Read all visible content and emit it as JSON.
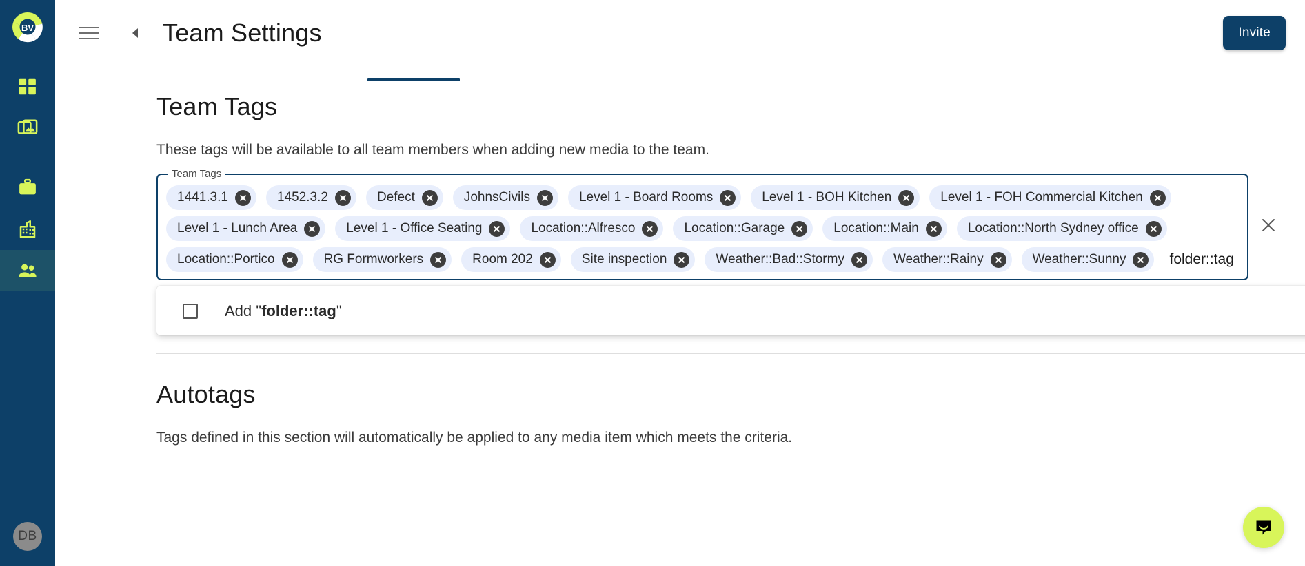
{
  "colors": {
    "sidebar_bg": "#0d4068",
    "sidebar_accent": "#d8f55a",
    "sidebar_active": "#1d5268",
    "primary": "#0d4068",
    "chip_bg": "#e8eefc",
    "chat_bubble": "#d8f55a"
  },
  "sidebar": {
    "logo_text": "BV",
    "items": [
      {
        "name": "dashboard",
        "icon": "grid-icon"
      },
      {
        "name": "media",
        "icon": "photo-library-icon"
      },
      {
        "name": "projects",
        "icon": "briefcase-icon"
      },
      {
        "name": "organisations",
        "icon": "building-icon"
      },
      {
        "name": "team",
        "icon": "people-icon"
      }
    ],
    "avatar_initials": "DB"
  },
  "header": {
    "menu_icon": "hamburger-icon",
    "back_icon": "caret-left-icon",
    "title": "Team Settings",
    "invite_label": "Invite"
  },
  "team_tags": {
    "heading": "Team Tags",
    "description": "These tags will be available to all team members when adding new media to the team.",
    "legend": "Team Tags",
    "tags": [
      "1441.3.1",
      "1452.3.2",
      "Defect",
      "JohnsCivils",
      "Level 1 - Board Rooms",
      "Level 1 - BOH Kitchen",
      "Level 1 - FOH Commercial Kitchen",
      "Level 1 - Lunch Area",
      "Level 1 - Office Seating",
      "Location::Alfresco",
      "Location::Garage",
      "Location::Main",
      "Location::North Sydney office",
      "Location::Portico",
      "RG Formworkers",
      "Room 202",
      "Site inspection",
      "Weather::Bad::Stormy",
      "Weather::Rainy",
      "Weather::Sunny"
    ],
    "input_value": "folder::tag",
    "clear_icon": "close-icon",
    "suggestion": {
      "prefix": "Add \"",
      "value": "folder::tag",
      "suffix": "\"",
      "checked": false
    }
  },
  "autotags": {
    "heading": "Autotags",
    "description": "Tags defined in this section will automatically be applied to any media item which meets the criteria."
  },
  "chat": {
    "icon": "chat-bubble-icon"
  }
}
